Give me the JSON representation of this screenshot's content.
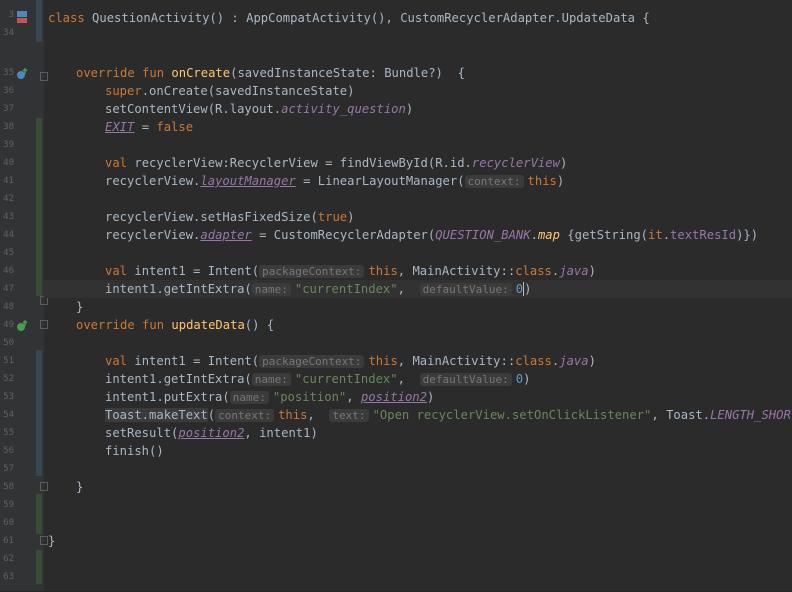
{
  "colors": {
    "background": "#2b2b2b",
    "gutter": "#313335",
    "keyword": "#cc7832",
    "function": "#ffc66d",
    "string": "#6a8759",
    "number": "#6897bb",
    "property": "#9876aa",
    "text": "#a9b7c6",
    "vcs_modified": "#374752",
    "vcs_added": "#384c38"
  },
  "gutter": {
    "line_numbers": [
      "3",
      "34",
      "35",
      "36",
      "37",
      "38",
      "39",
      "40",
      "41",
      "42",
      "43",
      "44",
      "45",
      "46",
      "47",
      "48",
      "49",
      "50",
      "51",
      "52",
      "53",
      "54",
      "55",
      "56",
      "57",
      "58",
      "59",
      "60",
      "61",
      "62",
      "63",
      "64"
    ],
    "icons": [
      "class-icon",
      "override-icon",
      "override-icon"
    ]
  },
  "code": {
    "l1": {
      "kw1": "class",
      "name": " QuestionActivity() : AppCompatActivity(), CustomRecyclerAdapter.UpdateData {"
    },
    "l4": {
      "kw1": "override fun",
      "fn": "onCreate",
      "rest": "(savedInstanceState: Bundle?)  {"
    },
    "l5": {
      "kw": "super",
      "rest": ".onCreate(savedInstanceState)"
    },
    "l6": {
      "a": "setContentView(R.layout.",
      "b": "activity_question",
      "c": ")"
    },
    "l7": {
      "a": "EXIT",
      "b": " = ",
      "c": "false"
    },
    "l9": {
      "kw": "val",
      "a": " recyclerView:RecyclerView = findViewById(R.id.",
      "b": "recyclerView",
      "c": ")"
    },
    "l10": {
      "a": "recyclerView.",
      "b": "layoutManager",
      "c": " = LinearLayoutManager(",
      "hint": "context:",
      "d": "this",
      "e": ")"
    },
    "l12": {
      "a": "recyclerView.setHasFixedSize(",
      "b": "true",
      "c": ")"
    },
    "l13": {
      "a": "recyclerView.",
      "b": "adapter",
      "c": " = CustomRecyclerAdapter(",
      "d": "QUESTION_BANK",
      "e": ".",
      "f": "map",
      "g": " {getString(",
      "h": "it",
      "i": ".",
      "j": "textResId",
      "k": ")})"
    },
    "l15": {
      "kw": "val",
      "a": " intent1 = Intent(",
      "hint": "packageContext:",
      "b": "this",
      "c": ", MainActivity::",
      "d": "class",
      "e": ".",
      "f": "java",
      "g": ")"
    },
    "l16": {
      "a": "intent1.getIntExtra(",
      "hint1": "name:",
      "b": "\"currentIndex\"",
      "c": ",  ",
      "hint2": "defaultValue:",
      "d": "0",
      "e": ")"
    },
    "l17": {
      "a": "}"
    },
    "l18": {
      "kw1": "override fun",
      "fn": "updateData",
      "rest": "() {"
    },
    "l20": {
      "kw": "val",
      "a": " intent1 = Intent(",
      "hint": "packageContext:",
      "b": "this",
      "c": ", MainActivity::",
      "d": "class",
      "e": ".",
      "f": "java",
      "g": ")"
    },
    "l21": {
      "a": "intent1.getIntExtra(",
      "hint1": "name:",
      "b": "\"currentIndex\"",
      "c": ",  ",
      "hint2": "defaultValue:",
      "d": "0",
      "e": ")"
    },
    "l22": {
      "a": "intent1.putExtra(",
      "hint": "name:",
      "b": "\"position\"",
      "c": ", ",
      "d": "position2",
      "e": ")"
    },
    "l23": {
      "a": "Toast.makeText",
      "b": "(",
      "hint1": "context:",
      "c": "this",
      "d": ",  ",
      "hint2": "text:",
      "e": "\"Open recyclerView.setOnClickListener\"",
      "f": ", Toast.",
      "g": "LENGTH_SHORT",
      "h": ")"
    },
    "l24": {
      "a": "setResult(",
      "b": "position2",
      "c": ", intent1)"
    },
    "l25": {
      "a": "finish()"
    },
    "l27": {
      "a": "}"
    },
    "l30": {
      "a": "}"
    }
  }
}
